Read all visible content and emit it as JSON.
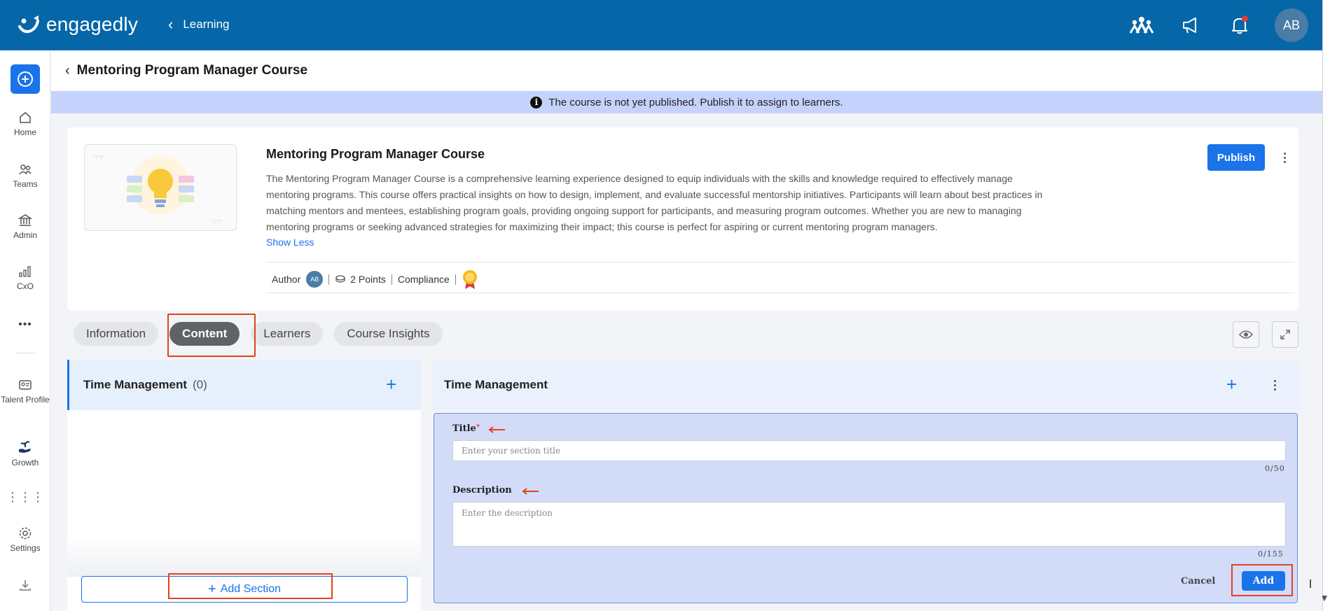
{
  "brand": {
    "name": "engagedly",
    "primary": "#0567a8",
    "accent": "#1a73e8",
    "highlight": "#e2421d"
  },
  "topbar": {
    "back_label": "Learning",
    "icons": [
      "people-icon",
      "megaphone-icon",
      "bell-icon"
    ],
    "avatar_initials": "AB"
  },
  "sidebar": {
    "items": [
      {
        "label": "Home",
        "icon": "home-icon"
      },
      {
        "label": "Teams",
        "icon": "teams-icon"
      },
      {
        "label": "Admin",
        "icon": "admin-icon"
      },
      {
        "label": "CxO",
        "icon": "chart-icon"
      },
      {
        "label": "Talent Profile",
        "icon": "id-card-icon"
      },
      {
        "label": "Growth",
        "icon": "growth-icon"
      },
      {
        "label": "Settings",
        "icon": "gear-icon"
      }
    ]
  },
  "page": {
    "title": "Mentoring Program Manager Course",
    "banner": "The course is not yet published. Publish it to assign to learners."
  },
  "course": {
    "name": "Mentoring Program Manager Course",
    "description": "The Mentoring Program Manager Course is a comprehensive learning experience designed to equip individuals with the skills and knowledge required to effectively manage mentoring programs. This course offers practical insights on how to design, implement, and evaluate successful mentorship initiatives. Participants will learn about best practices in matching mentors and mentees, establishing program goals, providing ongoing support for participants, and measuring program outcomes. Whether you are new to managing mentoring programs or seeking advanced strategies for maximizing their impact; this course is perfect for aspiring or current mentoring program managers.",
    "show_less": "Show Less",
    "author_label": "Author",
    "author_initials": "AB",
    "points": "2 Points",
    "category": "Compliance",
    "publish_label": "Publish"
  },
  "tabs": [
    {
      "label": "Information",
      "active": false
    },
    {
      "label": "Content",
      "active": true
    },
    {
      "label": "Learners",
      "active": false
    },
    {
      "label": "Course Insights",
      "active": false
    }
  ],
  "left_panel": {
    "section_title": "Time Management",
    "section_count": "(0)",
    "add_section_label": "Add Section"
  },
  "right_panel": {
    "title": "Time Management",
    "form": {
      "title_label": "Title",
      "title_required": "*",
      "title_placeholder": "Enter your section title",
      "title_count": "0/50",
      "description_label": "Description",
      "description_placeholder": "Enter the description",
      "description_count": "0/155",
      "cancel_label": "Cancel",
      "add_label": "Add"
    }
  }
}
